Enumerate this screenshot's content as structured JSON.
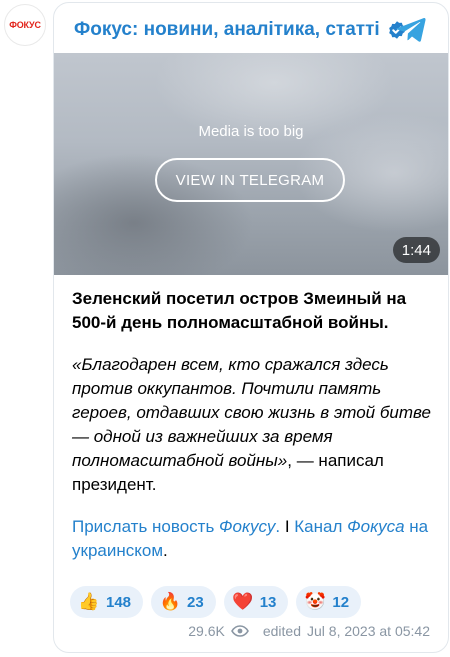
{
  "channel": {
    "avatar_text": "ФОКУС",
    "title": "Фокус: новини, аналітика, статті"
  },
  "media": {
    "notice": "Media is too big",
    "view_button": "VIEW IN TELEGRAM",
    "duration": "1:44"
  },
  "post": {
    "headline": "Зеленский посетил остров Змеиный на 500-й день полномасштабной войны.",
    "quote_italic": "«Благодарен всем, кто сражался здесь против оккупантов. Почтили память героев, отдавших свою жизнь в этой битве — одной из важнейших за время полномасштабной войны»",
    "quote_tail": ", — написал президент.",
    "link1_a": "Прислать новость ",
    "link1_b": "Фокусу",
    "link1_c": ".",
    "separator": " I ",
    "link2_a": "Канал ",
    "link2_b": "Фокуса",
    "link2_c": " на украинском",
    "link2_end": "."
  },
  "reactions": [
    {
      "emoji": "👍",
      "count": "148"
    },
    {
      "emoji": "🔥",
      "count": "23"
    },
    {
      "emoji": "❤️",
      "count": "13"
    },
    {
      "emoji": "🤡",
      "count": "12"
    }
  ],
  "meta": {
    "views": "29.6K",
    "status": "edited",
    "date": "Jul 8, 2023 at 05:42"
  },
  "colors": {
    "accent": "#2481cc",
    "brand_red": "#e2231a",
    "reaction_bg": "#e9f1fa",
    "meta_gray": "#8a96a3"
  }
}
